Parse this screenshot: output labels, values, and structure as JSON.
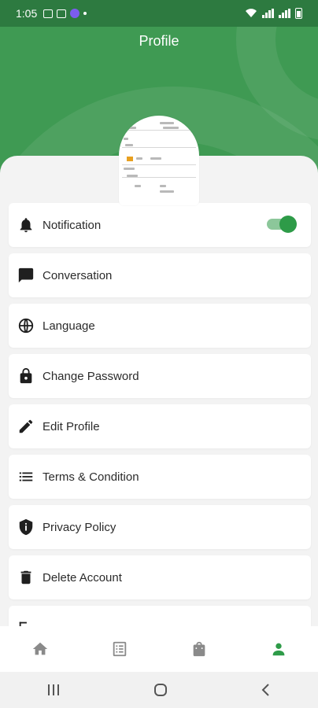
{
  "status_bar": {
    "time": "1:05"
  },
  "header": {
    "title": "Profile"
  },
  "menu": {
    "items": [
      {
        "label": "Notification",
        "icon": "bell-icon",
        "toggle_on": true
      },
      {
        "label": "Conversation",
        "icon": "chat-icon"
      },
      {
        "label": "Language",
        "icon": "globe-icon"
      },
      {
        "label": "Change Password",
        "icon": "lock-icon"
      },
      {
        "label": "Edit Profile",
        "icon": "pencil-icon"
      },
      {
        "label": "Terms & Condition",
        "icon": "list-icon"
      },
      {
        "label": "Privacy Policy",
        "icon": "shield-icon"
      },
      {
        "label": "Delete Account",
        "icon": "trash-icon"
      }
    ]
  },
  "bottom_nav": {
    "items": [
      "home-icon",
      "document-list-icon",
      "shopping-bag-icon",
      "person-icon"
    ],
    "active_index": 3
  },
  "colors": {
    "brand": "#3f9a53",
    "active": "#2e9b48",
    "inactive": "#8a8a8a"
  }
}
